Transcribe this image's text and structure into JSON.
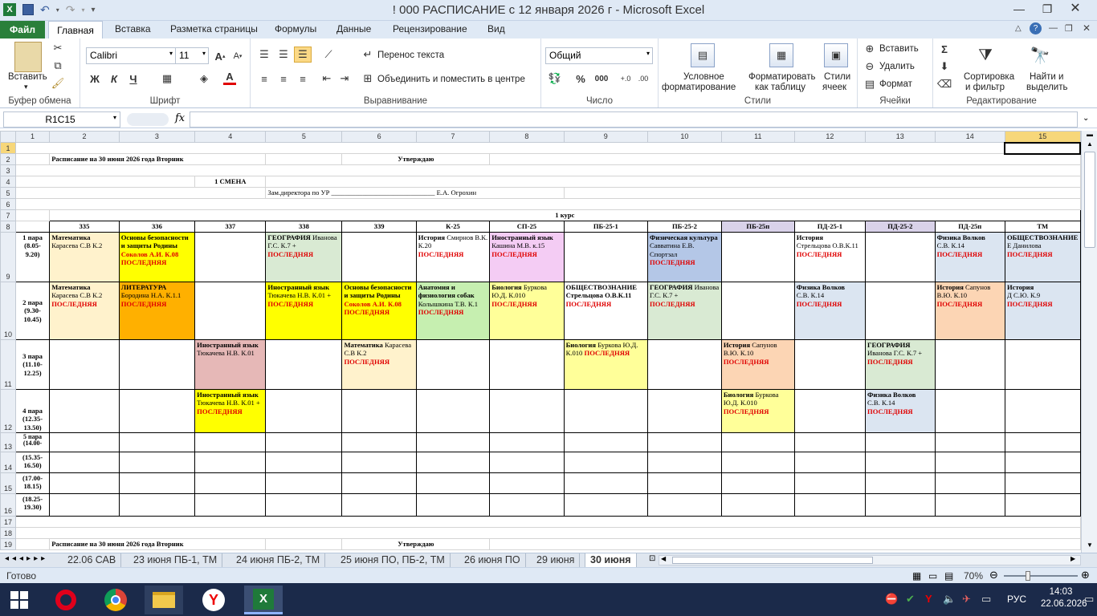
{
  "window": {
    "title": "! 000 РАСПИСАНИЕ с 12 января 2026 г  -  Microsoft Excel",
    "app_icon": "X"
  },
  "tabs": [
    "Файл",
    "Главная",
    "Вставка",
    "Разметка страницы",
    "Формулы",
    "Данные",
    "Рецензирование",
    "Вид"
  ],
  "ribbon": {
    "clipboard": {
      "paste": "Вставить",
      "label": "Буфер обмена"
    },
    "font": {
      "name": "Calibri",
      "size": "11",
      "bold": "Ж",
      "italic": "К",
      "underline": "Ч",
      "label": "Шрифт"
    },
    "alignment": {
      "wrap": "Перенос текста",
      "merge": "Объединить и поместить в центре",
      "label": "Выравнивание"
    },
    "number": {
      "format": "Общий",
      "label": "Число"
    },
    "styles": {
      "cond1": "Условное",
      "cond2": "форматирование",
      "table1": "Форматировать",
      "table2": "как таблицу",
      "cell1": "Стили",
      "cell2": "ячеек",
      "label": "Стили"
    },
    "cells": {
      "insert": "Вставить",
      "delete": "Удалить",
      "format": "Формат",
      "label": "Ячейки"
    },
    "editing": {
      "sort1": "Сортировка",
      "sort2": "и фильтр",
      "find1": "Найти и",
      "find2": "выделить",
      "label": "Редактирование"
    }
  },
  "formula": {
    "name_box": "R1C15",
    "fx": "fx",
    "content": ""
  },
  "columns": [
    "1",
    "2",
    "3",
    "4",
    "5",
    "6",
    "7",
    "8",
    "9",
    "10",
    "11",
    "12",
    "13",
    "14",
    "15"
  ],
  "sheet": {
    "r2_title": "Расписание на 30 июня 2026 года  Вторник",
    "r2_approve": "Утверждаю",
    "r4_shift": "1 СМЕНА",
    "r5_director": "Зам.директора по УР  ______________________________  Е.А. Огрохин",
    "r7_course": "1 курс",
    "groups": [
      "335",
      "336",
      "337",
      "338",
      "339",
      "К-25",
      "СП-25",
      "ПБ-25-1",
      "ПБ-25-2",
      "ПБ-25п",
      "ПД-25-1",
      "ПД-25-2",
      "ПД-25п",
      "ТМ"
    ],
    "pairs": [
      {
        "name": "1 пара",
        "time": "(8.05-9.20)"
      },
      {
        "name": "2 пара",
        "time": "(9.30-10.45)"
      },
      {
        "name": "3 пара",
        "time": "(11.10-12.25)"
      },
      {
        "name": "4 пара",
        "time": "(12.35-13.50)"
      },
      {
        "name": "5 пара",
        "time": "(14.00-"
      },
      {
        "name": "",
        "time": "(15.35-16.50)"
      },
      {
        "name": "",
        "time": "(17.00-18.15)"
      },
      {
        "name": "",
        "time": "(18.25-19.30)"
      }
    ],
    "last": "ПОСЛЕДНЯЯ",
    "r19_title": "Расписание на 30 июня 2026 года  Вторник",
    "r19_approve": "Утверждаю"
  },
  "lessons": {
    "r1c2": {
      "subj": "Математика",
      "teacher": "Карасева С.В К.2"
    },
    "r1c3": {
      "subj": "Основы безопасности и защиты Родины",
      "teacher": "Соколов А.И. К.08"
    },
    "r1c5": {
      "subj": "ГЕОГРАФИЯ",
      "teacher": "Иванова Г.С. К.7 +"
    },
    "r1c7": {
      "subj": "История",
      "teacher": "Смирнов В.К. К.20"
    },
    "r1c8": {
      "subj": "Иностранный язык",
      "teacher": "Кашина М.В. к.15"
    },
    "r1c10": {
      "subj": "Физическая культура",
      "teacher": "Савватина Е.В. Спортзал"
    },
    "r1c12": {
      "subj": "История",
      "teacher": "Стрельцова О.В.К.11"
    },
    "r1c14": {
      "subj": "Физика   Волков",
      "teacher": "С.В. К.14"
    },
    "r1c15": {
      "subj": "ОБЩЕСТВОЗНАНИЕ",
      "teacher": "Е Данилова"
    },
    "r2c2": {
      "subj": "Математика",
      "teacher": "Карасева С.В К.2"
    },
    "r2c3": {
      "subj": "ЛИТЕРАТУРА",
      "teacher": "Бородина Н.А. К.1.1"
    },
    "r2c5": {
      "subj": "Иностранный язык",
      "teacher": "Тюкачева Н.В. К.01 +"
    },
    "r2c6": {
      "subj": "Основы безопасности и защиты Родины",
      "teacher": "Соколов А.И. К.08"
    },
    "r2c7": {
      "subj": "Анатомия и физиология собак",
      "teacher": "Колышкина Т.В. К.1"
    },
    "r2c8": {
      "subj": "Биология",
      "teacher": "Буркова Ю.Д. К.010"
    },
    "r2c9": {
      "subj": "ОБЩЕСТВОЗНАНИЕ",
      "teacher": "Стрельцова О.В.К.11"
    },
    "r2c10": {
      "subj": "ГЕОГРАФИЯ",
      "teacher": "Иванова Г.С. К.7 +"
    },
    "r2c12": {
      "subj": "Физика   Волков",
      "teacher": "С.В. К.14"
    },
    "r2c14": {
      "subj": "История",
      "teacher": "Сапунов В.Ю. К.10"
    },
    "r2c15": {
      "subj": "История",
      "teacher": "Д С.Ю. К.9"
    },
    "r3c4": {
      "subj": "Иностранный язык",
      "teacher": "Тюкачева Н.В. К.01"
    },
    "r3c6": {
      "subj": "Математика",
      "teacher": "Карасева С.В К.2"
    },
    "r3c9": {
      "subj": "Биология",
      "teacher": "Буркова Ю.Д. К.010"
    },
    "r3c11": {
      "subj": "История",
      "teacher": "Сапунов В.Ю. К.10"
    },
    "r3c13": {
      "subj": "ГЕОГРАФИЯ",
      "teacher": "Иванова Г.С. К.7 +"
    },
    "r4c4": {
      "subj": "Иностранный язык",
      "teacher": "Тюкачева Н.В. К.01 +"
    },
    "r4c11": {
      "subj": "Биология",
      "teacher": "Буркова Ю.Д. К.010"
    },
    "r4c13": {
      "subj": "Физика   Волков",
      "teacher": "С.В. К.14"
    }
  },
  "sheet_tabs": [
    "22.06 САВ",
    "23 июня ПБ-1, ТМ",
    "24 июня ПБ-2, ТМ",
    "25 июня ПО, ПБ-2, ТМ",
    "26 июня ПО",
    "29 июня",
    "30 июня"
  ],
  "status": {
    "ready": "Готово",
    "zoom": "70%"
  },
  "taskbar": {
    "lang": "РУС",
    "time": "14:03",
    "date": "22.06.2026"
  },
  "colors": {
    "excel_green": "#2a7f3a",
    "last_red": "#e00000",
    "taskbar": "#1b2a4a"
  }
}
